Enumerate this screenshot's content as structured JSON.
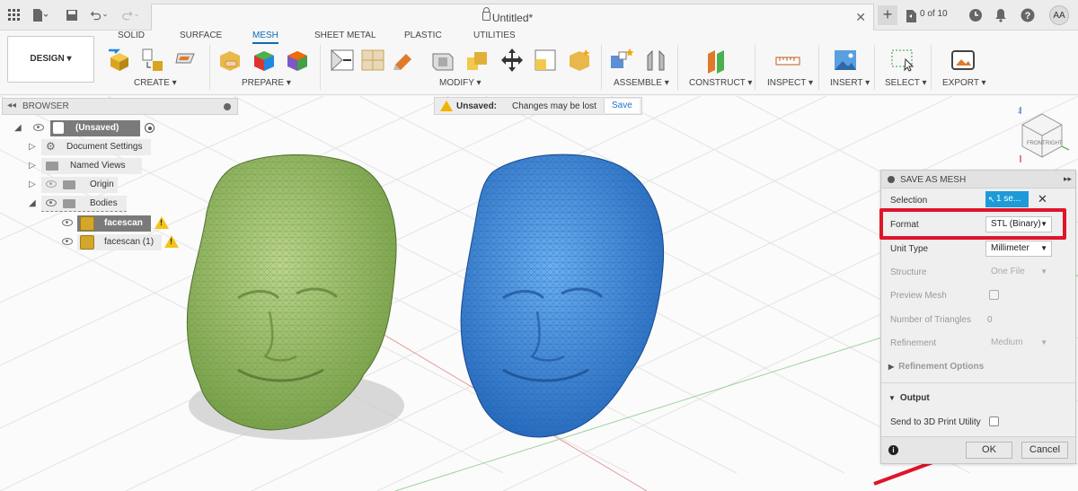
{
  "window": {
    "doc_title": "Untitled*",
    "jobs_status": "0 of 10",
    "user_initials": "AA"
  },
  "ribbon": {
    "workspace": "DESIGN ▾",
    "tabs": [
      "SOLID",
      "SURFACE",
      "MESH",
      "SHEET METAL",
      "PLASTIC",
      "UTILITIES"
    ],
    "active_tab": "MESH",
    "groups": {
      "create": "CREATE ▾",
      "prepare": "PREPARE ▾",
      "modify": "MODIFY ▾",
      "assemble": "ASSEMBLE ▾",
      "construct": "CONSTRUCT ▾",
      "inspect": "INSPECT ▾",
      "insert": "INSERT ▾",
      "select": "SELECT ▾",
      "export": "EXPORT ▾"
    }
  },
  "browser": {
    "title": "BROWSER",
    "root": "(Unsaved)",
    "items": {
      "document_settings": "Document Settings",
      "named_views": "Named Views",
      "origin": "Origin",
      "bodies": "Bodies",
      "body1": "facescan",
      "body2": "facescan (1)"
    }
  },
  "unsaved_bar": {
    "label": "Unsaved:",
    "message": "Changes may be lost",
    "save": "Save"
  },
  "viewcube": {
    "front": "FRONT",
    "right": "RIGHT",
    "axis_z": "Z"
  },
  "dialog": {
    "title": "SAVE AS MESH",
    "selection_label": "Selection",
    "selection_value": "1 se...",
    "format_label": "Format",
    "format_value": "STL (Binary)",
    "unit_label": "Unit Type",
    "unit_value": "Millimeter",
    "structure_label": "Structure",
    "structure_value": "One File",
    "preview_label": "Preview Mesh",
    "triangles_label": "Number of Triangles",
    "triangles_value": "0",
    "refinement_label": "Refinement",
    "refinement_value": "Medium",
    "refinement_options": "Refinement Options",
    "output_section": "Output",
    "send_label": "Send to 3D Print Utility",
    "ok": "OK",
    "cancel": "Cancel"
  },
  "colors": {
    "accent": "#0d6bb5",
    "highlight": "#e0142a",
    "green_mesh": "#8fbf5a",
    "blue_mesh": "#2e7bd4"
  }
}
